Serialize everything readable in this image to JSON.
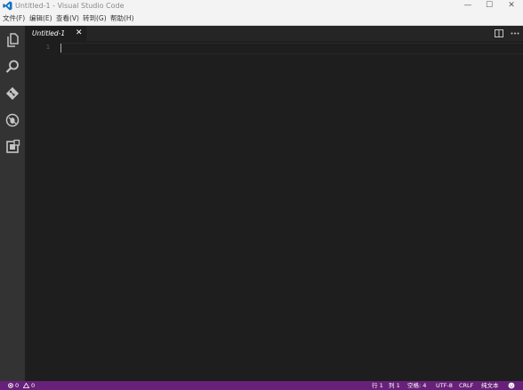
{
  "window": {
    "title": "Untitled-1 - Visual Studio Code",
    "minimize_glyph": "—",
    "maximize_glyph": "☐",
    "close_glyph": "✕"
  },
  "menu": [
    "文件(F)",
    "编辑(E)",
    "查看(V)",
    "转到(G)",
    "帮助(H)"
  ],
  "activity_icons": [
    "explorer-icon",
    "search-icon",
    "git-icon",
    "debug-icon",
    "extensions-icon"
  ],
  "tabs": [
    {
      "label": "Untitled-1",
      "close_glyph": "✕",
      "active": true
    }
  ],
  "tab_actions": [
    "split-editor-icon",
    "more-actions-icon"
  ],
  "editor": {
    "line_numbers": [
      "1"
    ]
  },
  "status": {
    "errors": "0",
    "warnings": "0",
    "line": "行 1",
    "column": "列 1",
    "spaces": "空格: 4",
    "encoding": "UTF-8",
    "eol": "CRLF",
    "language": "纯文本"
  },
  "colors": {
    "titlebar": "#f3f3f3",
    "activitybar": "#333333",
    "editor": "#1e1e1e",
    "tabs_background": "#252526",
    "statusbar": "#68217a",
    "vscode_blue": "#0e70c0"
  }
}
